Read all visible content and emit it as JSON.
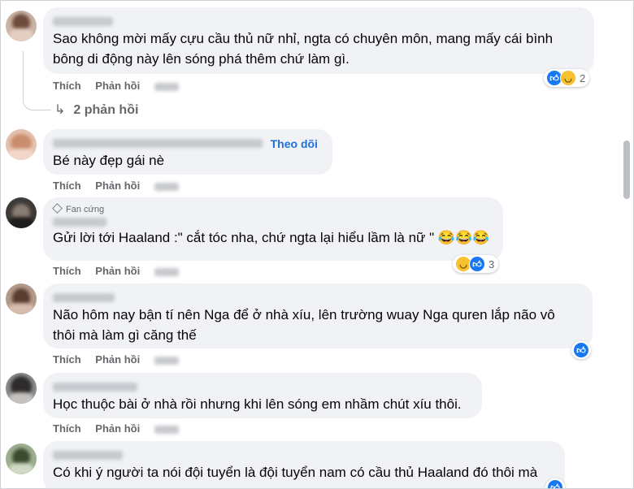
{
  "actions": {
    "like": "Thích",
    "reply": "Phản hồi"
  },
  "comments": [
    {
      "text_lines": [
        "Sao không mời mấy cựu cầu thủ nữ nhỉ, ngta có chuyên môn, mang mấy cái bình",
        "bông di động này lên sóng phá thêm chứ làm gì."
      ],
      "reaction_count": "2",
      "reactions": [
        "like-icon",
        "haha-icon"
      ]
    },
    {
      "follow": "Theo dõi",
      "text_lines": [
        "Bé này đẹp gái nè"
      ]
    },
    {
      "badge": "Fan cứng",
      "text_lines": [
        "Gửi lời tới Haaland :\" cắt tóc nha, chứ ngta lại hiểu lầm là nữ \" 😂😂😂"
      ],
      "reaction_count": "3",
      "reactions": [
        "haha-icon",
        "like-icon"
      ]
    },
    {
      "text_lines": [
        "Não hôm nay bận tí nên Nga để ở nhà xíu, lên trường wuay Nga quren lắp não vô",
        "thôi mà làm gì căng thế"
      ],
      "reactions": [
        "like-icon"
      ]
    },
    {
      "text_lines": [
        "Học thuộc bài ở nhà rồi nhưng khi lên sóng em nhầm chút xíu thôi."
      ]
    },
    {
      "text_lines": [
        "Có khi ý người ta nói đội tuyển là đội tuyển nam có cầu thủ Haaland đó thôi mà"
      ]
    }
  ],
  "replies_link": "2 phản hồi",
  "colors": {
    "bubble": "#f0f2f5",
    "like": "#1877f2",
    "follow": "#216fdb",
    "meta": "#65676b"
  }
}
